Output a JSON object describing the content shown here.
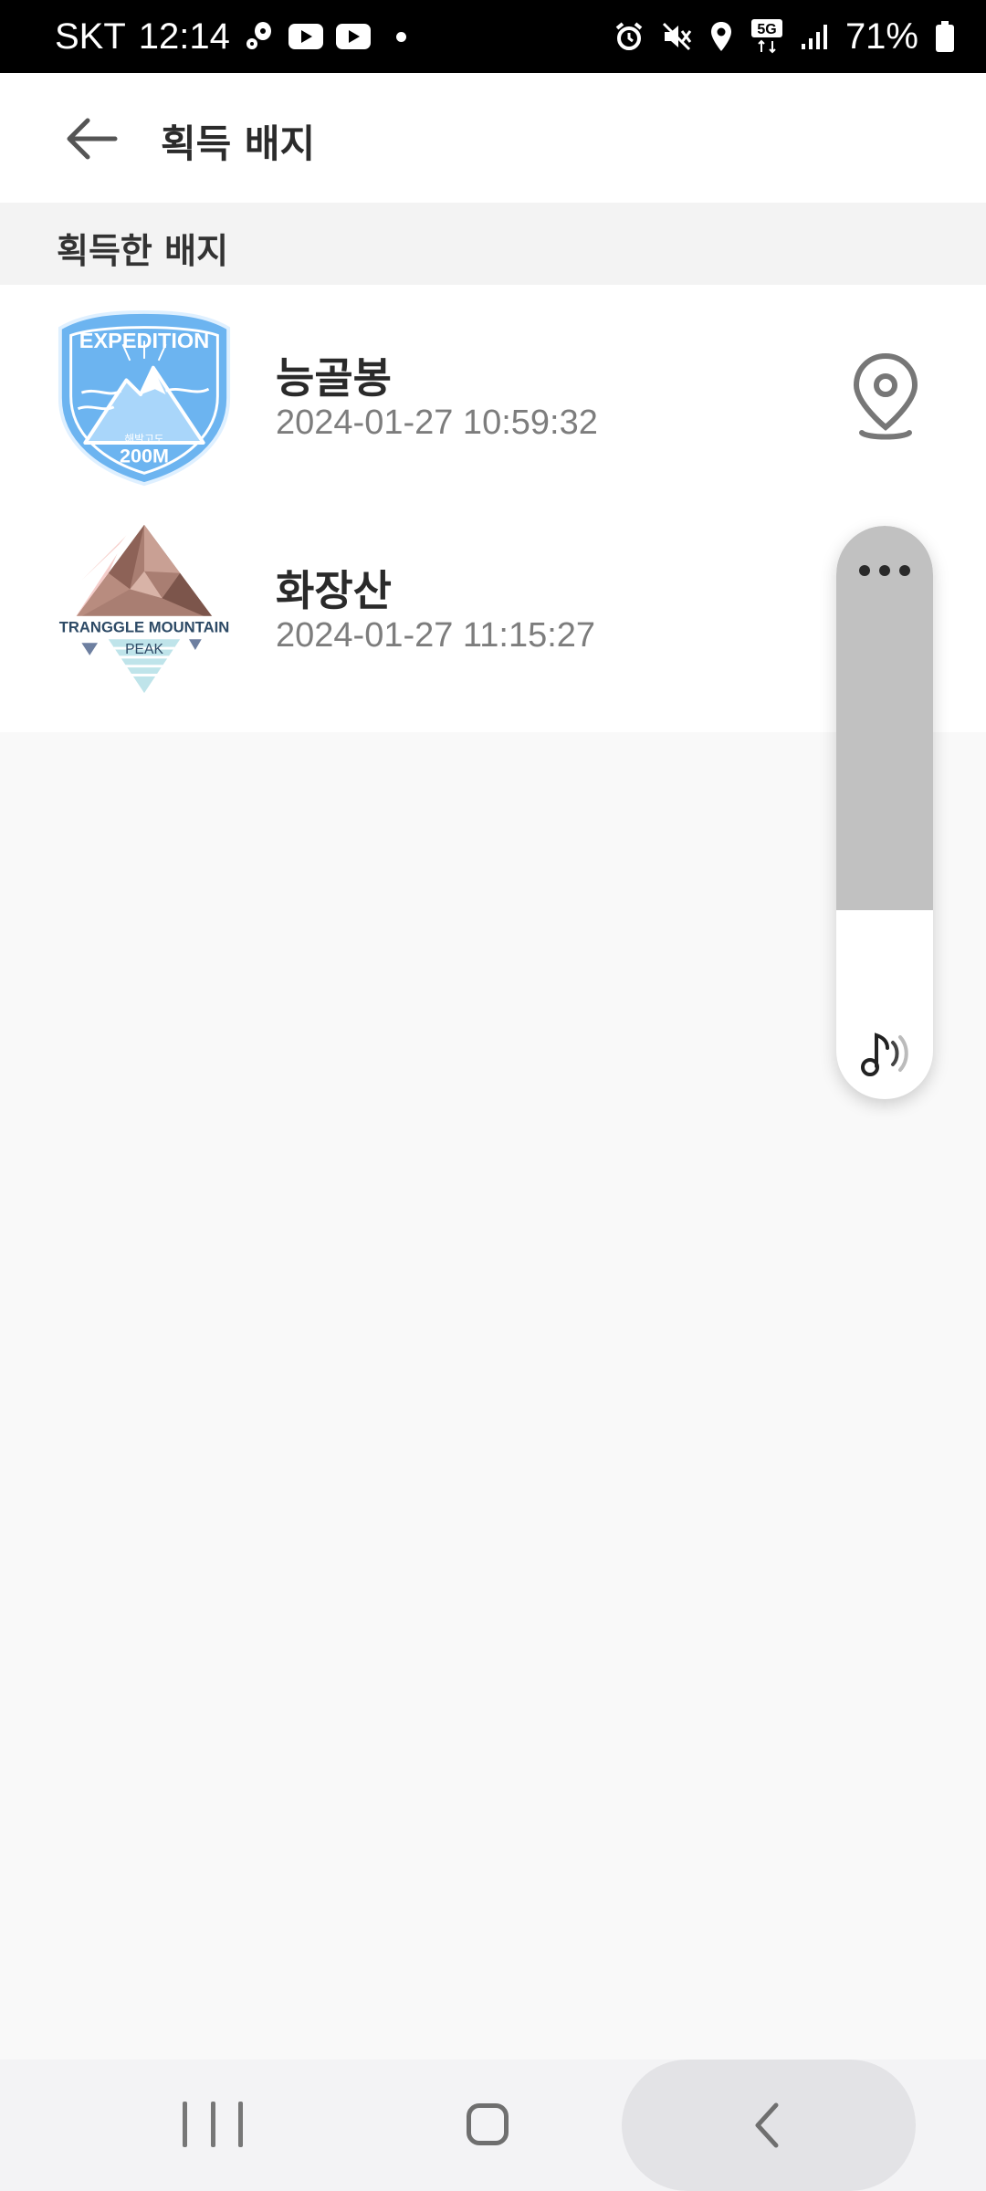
{
  "status_bar": {
    "carrier": "SKT",
    "time": "12:14",
    "battery": "71%",
    "network": "5G",
    "icons": [
      "footprint-icon",
      "youtube-icon",
      "youtube-icon",
      "notification-dot-icon",
      "alarm-icon",
      "mute-icon",
      "location-icon",
      "5g-icon",
      "signal-icon",
      "battery-icon"
    ]
  },
  "header": {
    "back_icon": "arrow-left-icon",
    "title": "획득 배지"
  },
  "section": {
    "title": "획득한 배지"
  },
  "badges": [
    {
      "name": "능골봉",
      "date": "2024-01-27 10:59:32",
      "badge_text_top": "EXPEDITION",
      "badge_text_bottom": "200M",
      "badge_text_small": "해발고도",
      "badge_color": "#6cb4f0",
      "has_location_icon": true
    },
    {
      "name": "화장산",
      "date": "2024-01-27 11:15:27",
      "badge_text_top": "TRANGGLE MOUNTAIN",
      "badge_text_bottom": "PEAK",
      "badge_color": "#a97e72"
    }
  ],
  "volume_panel": {
    "more_icon": "more-dots-icon",
    "media_icon": "music-volume-icon",
    "level": 0.33
  },
  "navigation_bar": {
    "recent_icon": "recent-apps-icon",
    "home_icon": "home-icon",
    "back_icon": "back-chevron-icon"
  }
}
